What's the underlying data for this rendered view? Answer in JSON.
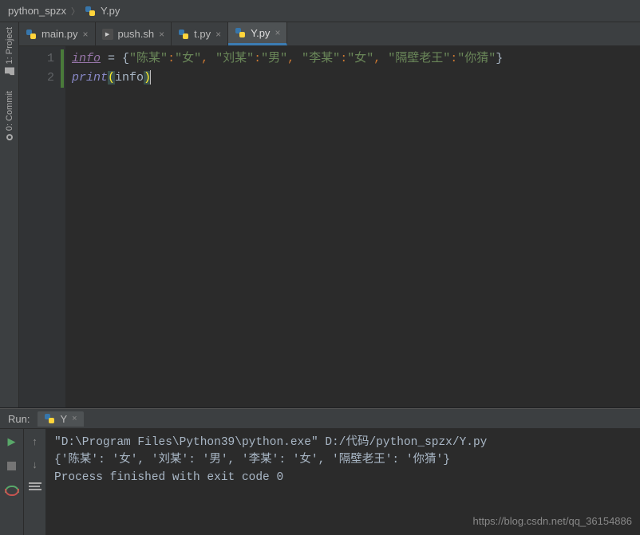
{
  "breadcrumb": {
    "project": "python_spzx",
    "file": "Y.py"
  },
  "tabs": [
    {
      "label": "main.py",
      "icon": "py",
      "active": false
    },
    {
      "label": "push.sh",
      "icon": "sh",
      "active": false
    },
    {
      "label": "t.py",
      "icon": "py",
      "active": false
    },
    {
      "label": "Y.py",
      "icon": "py",
      "active": true
    }
  ],
  "toolwindows": {
    "project": "1: Project",
    "commit": "0: Commit"
  },
  "code": {
    "lines": [
      "1",
      "2"
    ],
    "line1": {
      "var": "info",
      "eq": " = ",
      "lb": "{",
      "k1": "\"陈某\"",
      "v1": "\"女\"",
      "k2": "\"刘某\"",
      "v2": "\"男\"",
      "k3": "\"李某\"",
      "v3": "\"女\"",
      "k4": "\"隔壁老王\"",
      "v4": "\"你猜\"",
      "rb": "}",
      "colon": ":",
      "comma": ", "
    },
    "line2": {
      "fn": "print",
      "lp": "(",
      "arg": "info",
      "rp": ")"
    }
  },
  "run": {
    "title": "Run:",
    "tab": "Y",
    "console": {
      "line1": "\"D:\\Program Files\\Python39\\python.exe\" D:/代码/python_spzx/Y.py",
      "line2": "{'陈某': '女', '刘某': '男', '李某': '女', '隔壁老王': '你猜'}",
      "line3": "",
      "line4": "Process finished with exit code 0"
    }
  },
  "watermark": "https://blog.csdn.net/qq_36154886"
}
